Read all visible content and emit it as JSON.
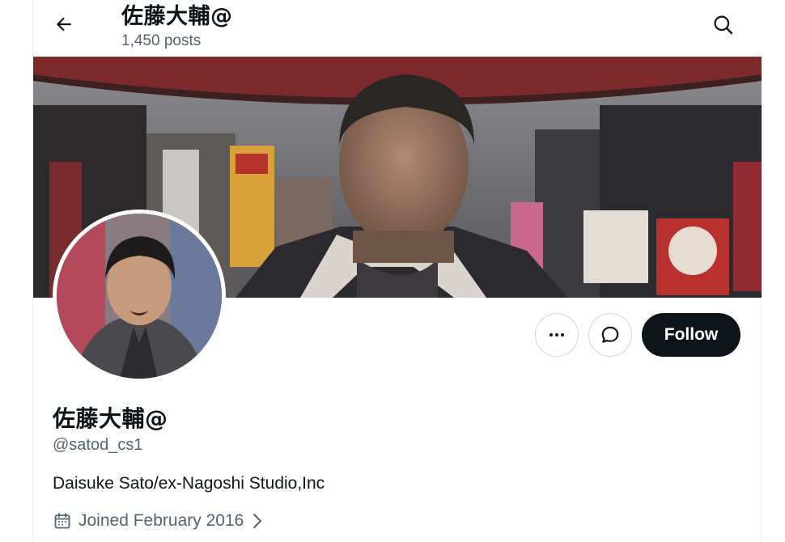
{
  "header": {
    "title": "佐藤大輔@",
    "posts_count": "1,450 posts"
  },
  "icons": {
    "back": "arrow-left-icon",
    "search": "search-icon",
    "more": "more-horizontal-icon",
    "message": "message-bubble-icon",
    "calendar": "calendar-icon",
    "chevron": "chevron-right-icon"
  },
  "profile": {
    "display_name": "佐藤大輔@",
    "handle": "@satod_cs1",
    "bio": "Daisuke Sato/ex-Nagoshi Studio,Inc",
    "joined": "Joined February 2016"
  },
  "actions": {
    "follow_label": "Follow"
  },
  "colors": {
    "primary_text": "#0f1419",
    "secondary_text": "#536471",
    "border": "#cfd9de",
    "follow_bg": "#0f1419",
    "follow_text": "#ffffff"
  }
}
